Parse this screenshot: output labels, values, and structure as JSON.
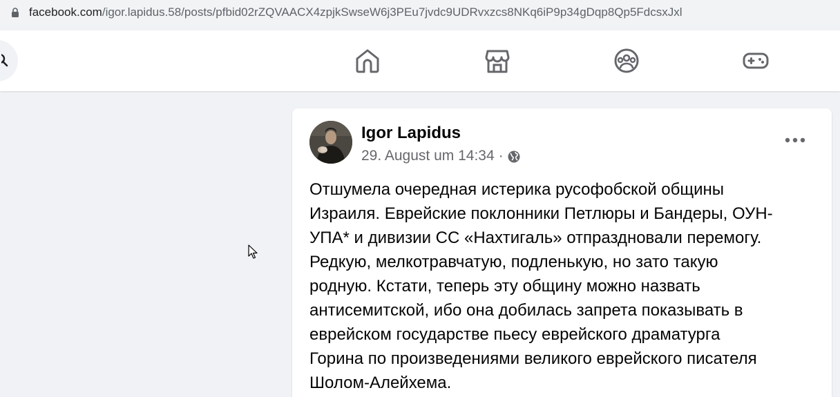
{
  "browser": {
    "url_host": "facebook.com",
    "url_path": "/igor.lapidus.58/posts/pfbid02rZQVAACX4zpjkSwseW6j3PEu7jvdc9UDRvxzcs8NKq6iP9p34gDqp8Qp5FdcsxJxl"
  },
  "nav": {
    "icons": [
      "home-icon",
      "marketplace-icon",
      "groups-icon",
      "gaming-icon"
    ]
  },
  "post": {
    "author": "Igor Lapidus",
    "timestamp": "29. August um 14:34",
    "separator": "·",
    "privacy_icon": "globe-icon",
    "text": "Отшумела очередная истерика русофобской общины\nИзраиля. Еврейские поклонники Петлюры и Бандеры, ОУН-\nУПА* и дивизии СС «Нахтигаль» отпраздновали перемогу.\nРедкую, мелкотравчатую, подленькую, но зато такую\nродную. Кстати, теперь эту общину можно назвать\nантисемитской, ибо она добилась запрета показывать в\nеврейском государстве пьесу еврейского драматурга\nГорина по произведениями великого еврейского писателя\nШолом-Алейхема."
  },
  "colors": {
    "page_bg": "#f0f2f5",
    "card_bg": "#ffffff",
    "icon_gray": "#65676b",
    "text_primary": "#050505"
  }
}
